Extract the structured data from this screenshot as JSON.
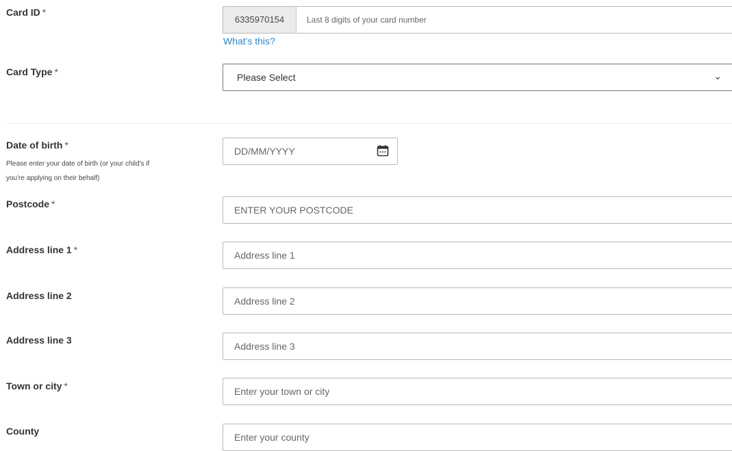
{
  "card_id": {
    "label": "Card ID",
    "required_mark": "*",
    "prefix": "6335970154",
    "placeholder": "Last 8 digits of your card number",
    "help_link": "What's this?"
  },
  "card_type": {
    "label": "Card Type",
    "required_mark": "*",
    "selected": "Please Select",
    "chevron_icon": "chevron-down-icon"
  },
  "dob": {
    "label": "Date of birth",
    "required_mark": "*",
    "help_line1": "Please enter your date of birth (or your child's if",
    "help_line2": "you're applying on their behalf)",
    "placeholder": "DD/MM/YYYY",
    "icon": "calendar-icon"
  },
  "postcode": {
    "label": "Postcode",
    "required_mark": "*",
    "placeholder": "ENTER YOUR POSTCODE"
  },
  "address1": {
    "label": "Address line 1",
    "required_mark": "*",
    "placeholder": "Address line 1"
  },
  "address2": {
    "label": "Address line 2",
    "placeholder": "Address line 2"
  },
  "address3": {
    "label": "Address line 3",
    "placeholder": "Address line 3"
  },
  "town": {
    "label": "Town or city",
    "required_mark": "*",
    "placeholder": "Enter your town or city"
  },
  "county": {
    "label": "County",
    "placeholder": "Enter your county"
  },
  "colors": {
    "link": "#2d86c9",
    "border": "#b8b8b8",
    "prefix_bg": "#ebebeb"
  }
}
